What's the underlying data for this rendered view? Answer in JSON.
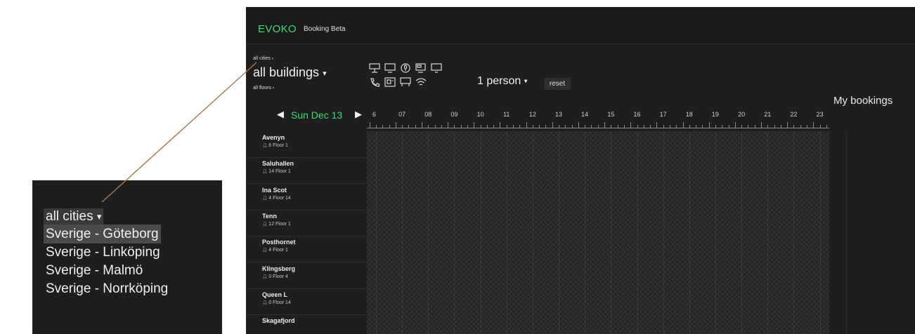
{
  "header": {
    "logo": "EVOKO",
    "subtitle": "Booking Beta"
  },
  "filters": {
    "cities": "all cities",
    "buildings": "all buildings",
    "floors": "all floors",
    "caret": "▾"
  },
  "amenity_icons": [
    "display-icon",
    "screen-icon",
    "microphone-icon",
    "monitor-icon",
    "tv-icon",
    "phone-icon",
    "video-icon",
    "whiteboard-icon",
    "wifi-icon"
  ],
  "persons": {
    "label": "1 person",
    "reset": "reset"
  },
  "my_bookings": "My bookings",
  "date_nav": {
    "prev": "◀",
    "label": "Sun Dec 13",
    "next": "▶"
  },
  "hours": [
    "6",
    "07",
    "08",
    "09",
    "10",
    "11",
    "12",
    "13",
    "14",
    "15",
    "16",
    "17",
    "18",
    "19",
    "20",
    "21",
    "22",
    "23"
  ],
  "rooms": [
    {
      "name": "Avenyn",
      "meta": "6 Floor 1"
    },
    {
      "name": "Saluhallen",
      "meta": "14 Floor 1"
    },
    {
      "name": "Ina Scot",
      "meta": "4 Floor 14"
    },
    {
      "name": "Tenn",
      "meta": "12 Floor 1"
    },
    {
      "name": "Posthornet",
      "meta": "4 Floor 1"
    },
    {
      "name": "Klingsberg",
      "meta": "0 Floor 4"
    },
    {
      "name": "Queen L",
      "meta": "0 Floor 14"
    },
    {
      "name": "Skagafjord",
      "meta": ""
    }
  ],
  "zoom": {
    "header": "all cities",
    "options": [
      "Sverige - Göteborg",
      "Sverige - Linköping",
      "Sverige - Malmö",
      "Sverige - Norrköping"
    ],
    "selected_index": 0
  },
  "colors": {
    "accent": "#3ddc74",
    "background": "#1c1c1c",
    "connector": "#a9764f"
  }
}
